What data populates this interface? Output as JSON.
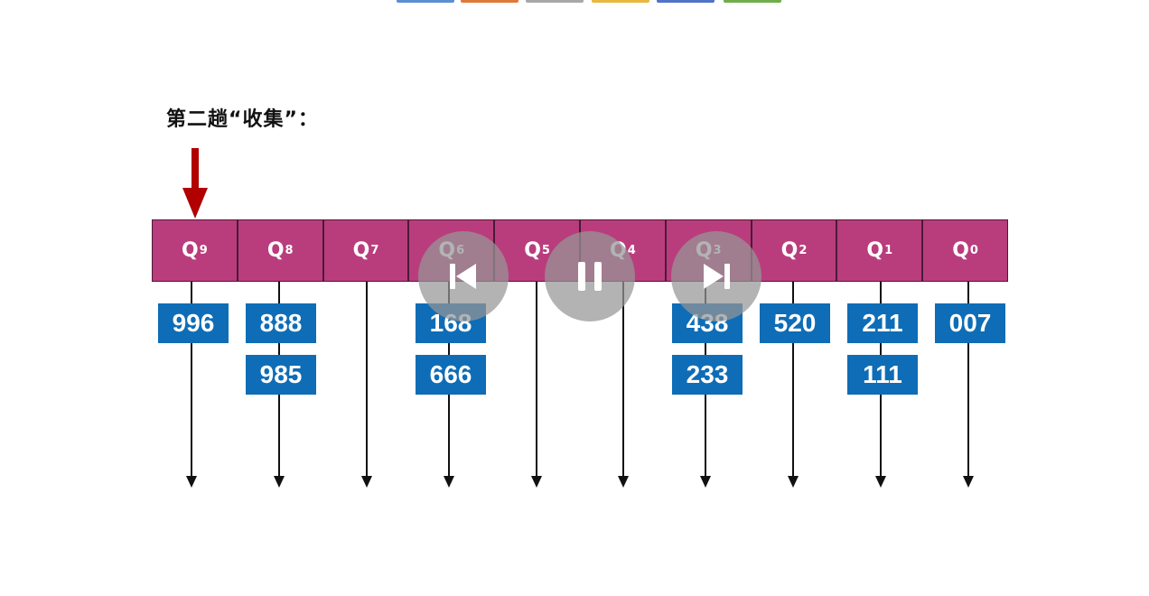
{
  "colors": {
    "queue_fill": "#b93d7d",
    "number_box": "#0e6db6",
    "pointer": "#b00000",
    "control_overlay": "#969696"
  },
  "top_tabs": [
    {
      "color": "#5b8fd2"
    },
    {
      "color": "#e07a3a"
    },
    {
      "color": "#a8a8a8"
    },
    {
      "color": "#e8b840"
    },
    {
      "color": "#4f73c8"
    },
    {
      "color": "#6fae4a"
    }
  ],
  "slide": {
    "title": "第二趟“收集”：",
    "queues": [
      {
        "label": "Q",
        "sub": "9",
        "items": [
          "996"
        ]
      },
      {
        "label": "Q",
        "sub": "8",
        "items": [
          "888",
          "985"
        ]
      },
      {
        "label": "Q",
        "sub": "7",
        "items": []
      },
      {
        "label": "Q",
        "sub": "6",
        "items": [
          "168",
          "666"
        ]
      },
      {
        "label": "Q",
        "sub": "5",
        "items": []
      },
      {
        "label": "Q",
        "sub": "4",
        "items": []
      },
      {
        "label": "Q",
        "sub": "3",
        "items": [
          "438",
          "233"
        ]
      },
      {
        "label": "Q",
        "sub": "2",
        "items": [
          "520"
        ]
      },
      {
        "label": "Q",
        "sub": "1",
        "items": [
          "211",
          "111"
        ]
      },
      {
        "label": "Q",
        "sub": "0",
        "items": [
          "007"
        ]
      }
    ],
    "pointer_queue": "Q9"
  },
  "player": {
    "controls": [
      {
        "name": "previous-button",
        "icon": "skip-previous-icon"
      },
      {
        "name": "pause-button",
        "icon": "pause-icon"
      },
      {
        "name": "next-button",
        "icon": "skip-next-icon"
      }
    ]
  }
}
